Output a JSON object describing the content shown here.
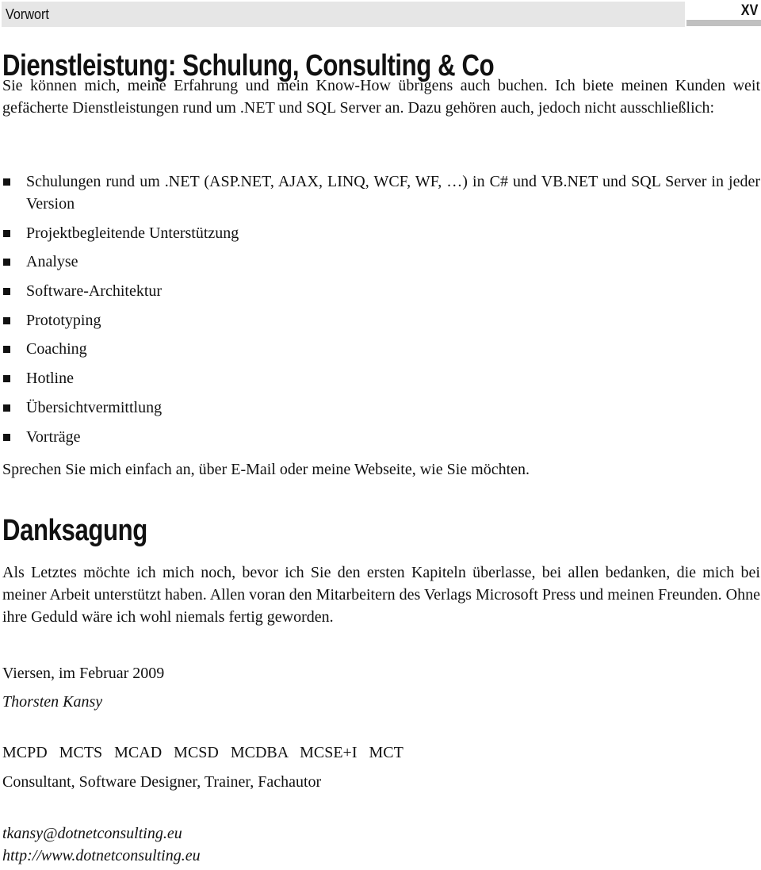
{
  "header": {
    "section_title": "Vorwort",
    "page_number": "XV"
  },
  "section1": {
    "heading": "Dienstleistung: Schulung, Consulting & Co",
    "intro": "Sie können mich, meine Erfahrung und mein Know-How übrigens auch buchen. Ich biete meinen Kunden weit gefächerte Dienstleistungen rund um .NET und SQL Server an. Dazu gehören auch, jedoch nicht ausschließlich:",
    "items": [
      "Schulungen rund um .NET (ASP.NET, AJAX, LINQ, WCF, WF, …) in C# und VB.NET und SQL Server in jeder Version",
      "Projektbegleitende Unterstützung",
      "Analyse",
      "Software-Architektur",
      "Prototyping",
      "Coaching",
      "Hotline",
      "Übersichtvermittlung",
      "Vorträge"
    ],
    "closing": "Sprechen Sie mich einfach an, über E-Mail oder meine Webseite, wie Sie möchten."
  },
  "section2": {
    "heading": "Danksagung",
    "text": "Als Letztes möchte ich mich noch, bevor ich Sie den ersten Kapiteln überlasse, bei allen bedanken, die mich bei meiner Arbeit unterstützt haben. Allen voran den Mitarbeitern des Verlags Microsoft Press und meinen Freunden. Ohne ihre Geduld wäre ich wohl niemals fertig geworden."
  },
  "signature": {
    "place_date": "Viersen, im Februar 2009",
    "author": "Thorsten Kansy",
    "certifications": "MCPD MCTS MCAD MCSD MCDBA MCSE+I MCT",
    "roles": "Consultant, Software Designer, Trainer, Fachautor",
    "email": "tkansy@dotnetconsulting.eu",
    "website": "http://www.dotnetconsulting.eu"
  }
}
